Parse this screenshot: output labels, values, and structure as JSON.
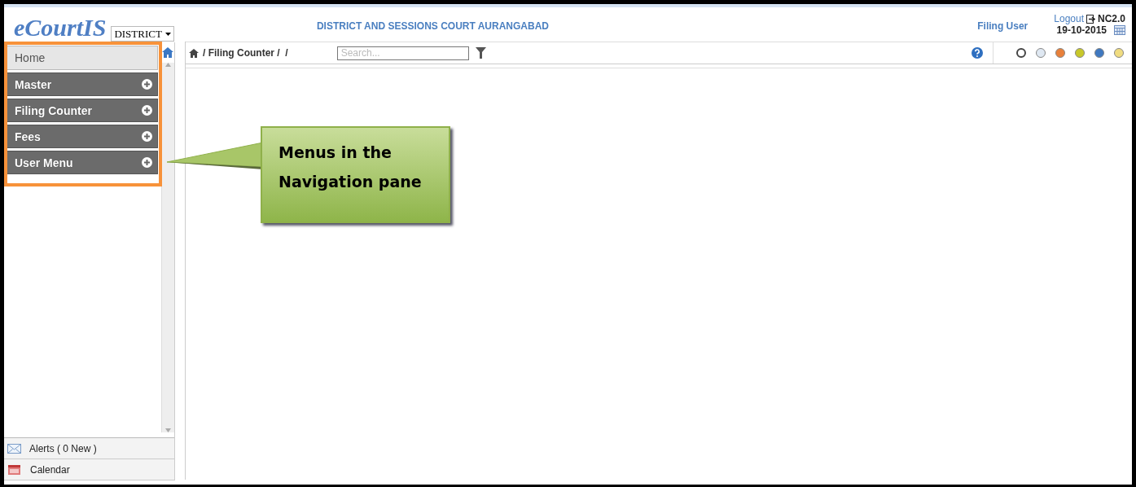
{
  "header": {
    "logo": "eCourtIS",
    "court_type": "DISTRICT",
    "court_name": "DISTRICT AND SESSIONS COURT AURANGABAD",
    "user": "Filing User",
    "logout": "Logout",
    "version": "NC2.0",
    "date": "19-10-2015"
  },
  "sidebar": {
    "items": [
      {
        "label": "Home",
        "kind": "home"
      },
      {
        "label": "Master",
        "kind": "menu",
        "expanded": false
      },
      {
        "label": "Filing Counter",
        "kind": "menu",
        "expanded": false
      },
      {
        "label": "Fees",
        "kind": "menu",
        "expanded": false
      },
      {
        "label": "User Menu",
        "kind": "menu",
        "expanded": false
      }
    ],
    "footer": [
      {
        "label": "Alerts ( 0 New  )",
        "kind": "alerts"
      },
      {
        "label": "Calendar",
        "kind": "calendar"
      }
    ]
  },
  "toolbar": {
    "breadcrumb": "/ Filing Counter /  /",
    "search": {
      "placeholder": "Search..."
    },
    "theme_colors": [
      {
        "color": "#ffffff",
        "selected": true
      },
      {
        "color": "#dfe8f2",
        "selected": false
      },
      {
        "color": "#e8803a",
        "selected": false
      },
      {
        "color": "#c8c82a",
        "selected": false
      },
      {
        "color": "#3f78c0",
        "selected": false
      },
      {
        "color": "#f0dc80",
        "selected": false
      }
    ]
  },
  "callout": {
    "text": "Menus in the Navigation pane"
  }
}
